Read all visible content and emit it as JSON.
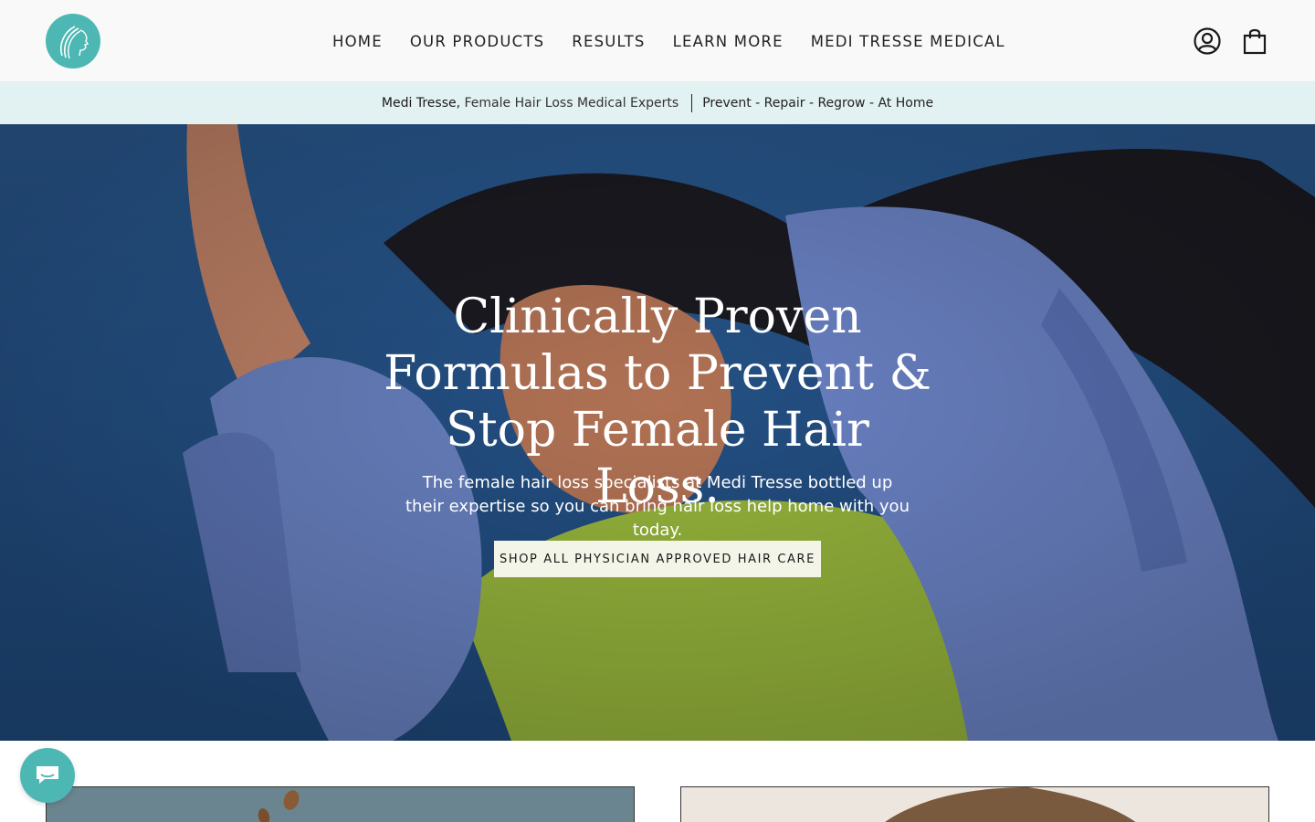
{
  "header": {
    "logo_alt": "Medi Tresse logo",
    "nav": [
      "HOME",
      "OUR PRODUCTS",
      "RESULTS",
      "LEARN MORE",
      "MEDI TRESSE MEDICAL"
    ],
    "account_icon": "account-icon",
    "cart_icon": "cart-icon"
  },
  "announcement": {
    "brand": "Medi Tresse,",
    "tagline": "Female Hair Loss Medical Experts",
    "slogan": "Prevent - Repair - Regrow - At Home"
  },
  "hero": {
    "title": "Clinically Proven Formulas to Prevent & Stop Female Hair Loss.",
    "subtitle": "The female hair loss specialists at Medi Tresse bottled up their expertise so you can bring hair loss help home with you today.",
    "cta": "SHOP ALL PHYSICIAN APPROVED HAIR CARE"
  },
  "chat": {
    "icon": "chat-icon"
  },
  "colors": {
    "brand_teal": "#4db8b3",
    "announce_bg": "#e2f1f1",
    "hero_sky": "#27548a",
    "cta_bg": "#f3f5e8"
  }
}
